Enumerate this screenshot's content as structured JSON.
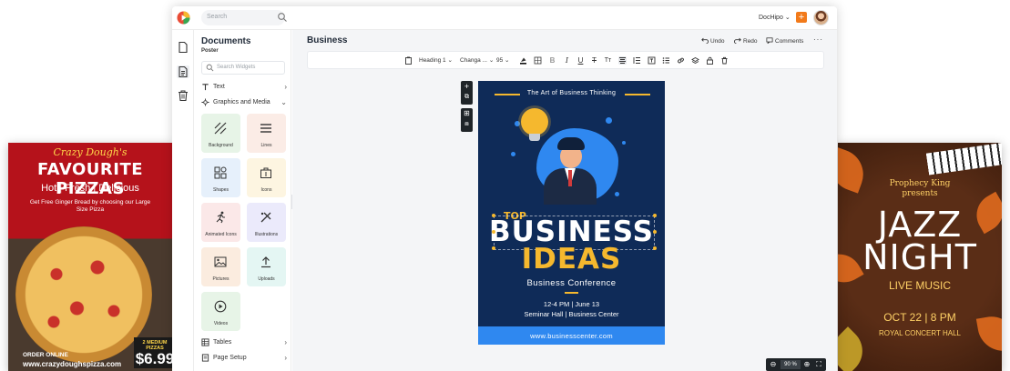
{
  "app": {
    "search_placeholder": "Search",
    "account_label": "DocHipo",
    "account_chevron": "⌄",
    "plus_label": "+"
  },
  "panel": {
    "title": "Documents",
    "subtitle": "Poster",
    "widget_search_placeholder": "Search Widgets",
    "sections": [
      {
        "label": "Text",
        "chevron": "›"
      },
      {
        "label": "Graphics and Media",
        "chevron": "⌄"
      },
      {
        "label": "Tables",
        "chevron": "›"
      },
      {
        "label": "Page Setup",
        "chevron": "›"
      }
    ],
    "tiles": [
      {
        "label": "Background",
        "color": "#e7f4e7"
      },
      {
        "label": "Lines",
        "color": "#fbece6"
      },
      {
        "label": "Shapes",
        "color": "#e6f0fb"
      },
      {
        "label": "Icons",
        "color": "#fdf5e1"
      },
      {
        "label": "Animated Icons",
        "color": "#fbe8e8"
      },
      {
        "label": "Illustrations",
        "color": "#ebeafb"
      },
      {
        "label": "Pictures",
        "color": "#fbecdf"
      },
      {
        "label": "Uploads",
        "color": "#e4f6f3"
      },
      {
        "label": "Videos",
        "color": "#e7f4e7"
      }
    ]
  },
  "editor": {
    "doc_title": "Business",
    "undo_label": "Undo",
    "redo_label": "Redo",
    "comments_label": "Comments",
    "more_label": "···",
    "toolbar": {
      "heading": "Heading 1",
      "font": "Changa ...",
      "size": "95",
      "chevron": "⌄"
    },
    "zoom": "90 %"
  },
  "poster": {
    "tagline": "The Art of Business Thinking",
    "top": "TOP",
    "headline1": "BUSINESS",
    "headline2": "IDEAS",
    "conference": "Business Conference",
    "time": "12-4 PM | June 13",
    "venue": "Seminar Hall | Business Center",
    "website": "www.businesscenter.com"
  },
  "pizza_poster": {
    "brand": "Crazy Dough's",
    "title": "FAVOURITE PIZZAS",
    "tagline": "Hot | Fresh | Delicious",
    "offer": "Get Free Ginger Bread by choosing our Large Size Pizza",
    "order": "ORDER ONLINE",
    "website": "www.crazydoughspizza.com",
    "deal": "2 MEDIUM PIZZAS",
    "price": "$6.99"
  },
  "jazz_poster": {
    "presenter": "Prophecy King",
    "presents": "presents",
    "title_line1": "JAZZ",
    "title_line2": "NIGHT",
    "subtitle": "LIVE MUSIC",
    "date": "OCT 22 | 8 PM",
    "venue": "ROYAL CONCERT HALL"
  },
  "colors": {
    "accent_orange": "#f27a1a",
    "poster_navy": "#0f2b58",
    "poster_blue": "#2f88f0",
    "poster_yellow": "#f5b82e"
  }
}
